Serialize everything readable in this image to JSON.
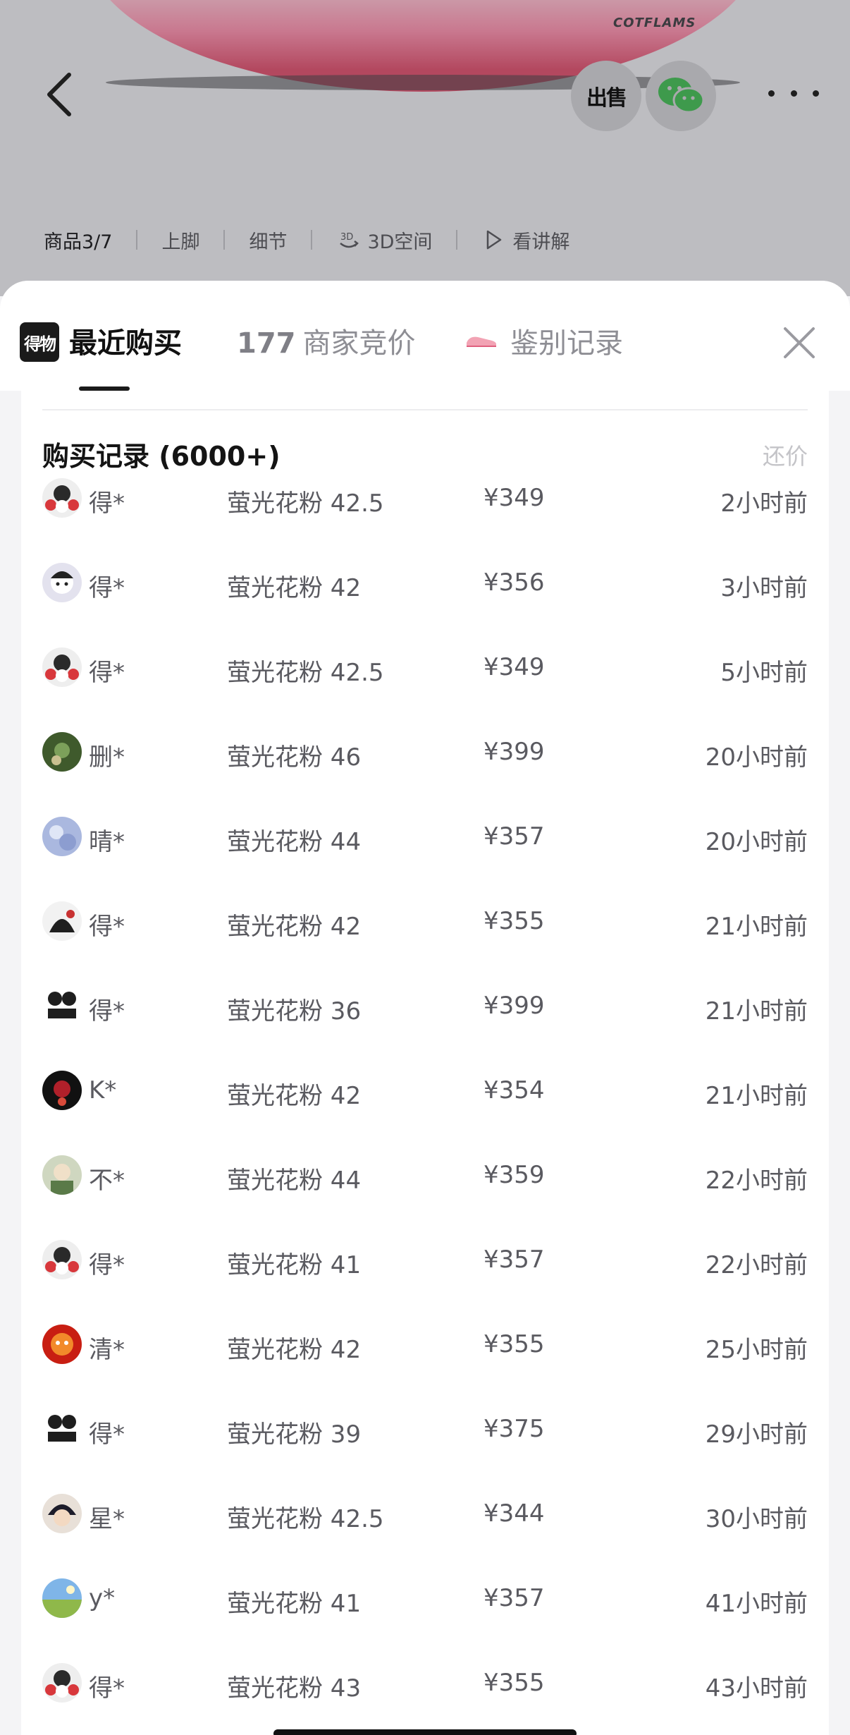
{
  "hero": {
    "brand_mark": "COTFLAMS",
    "sell_label": "出售",
    "media_tabs": [
      {
        "label": "商品3/7",
        "icon": ""
      },
      {
        "label": "上脚",
        "icon": ""
      },
      {
        "label": "细节",
        "icon": ""
      },
      {
        "label": "3D空间",
        "icon": "3d-icon"
      },
      {
        "label": "看讲解",
        "icon": "play-icon"
      }
    ]
  },
  "sheet": {
    "logo_text": "得物",
    "tabs": {
      "recent": "最近购买",
      "bids_count": "177",
      "bids_label": "商家竞价",
      "auth": "鉴别记录"
    },
    "records_title": "购买记录 (6000+)",
    "counter_offer": "还价",
    "rows": [
      {
        "user": "得*",
        "spec": "萤光花粉 42.5",
        "price": "¥349",
        "time": "2小时前",
        "avatar": "a1"
      },
      {
        "user": "得*",
        "spec": "萤光花粉 42",
        "price": "¥356",
        "time": "3小时前",
        "avatar": "a2"
      },
      {
        "user": "得*",
        "spec": "萤光花粉 42.5",
        "price": "¥349",
        "time": "5小时前",
        "avatar": "a1"
      },
      {
        "user": "删*",
        "spec": "萤光花粉 46",
        "price": "¥399",
        "time": "20小时前",
        "avatar": "a3"
      },
      {
        "user": "晴*",
        "spec": "萤光花粉 44",
        "price": "¥357",
        "time": "20小时前",
        "avatar": "a4"
      },
      {
        "user": "得*",
        "spec": "萤光花粉 42",
        "price": "¥355",
        "time": "21小时前",
        "avatar": "a5"
      },
      {
        "user": "得*",
        "spec": "萤光花粉 36",
        "price": "¥399",
        "time": "21小时前",
        "avatar": "a6"
      },
      {
        "user": "K*",
        "spec": "萤光花粉 42",
        "price": "¥354",
        "time": "21小时前",
        "avatar": "a7"
      },
      {
        "user": "不*",
        "spec": "萤光花粉 44",
        "price": "¥359",
        "time": "22小时前",
        "avatar": "a8"
      },
      {
        "user": "得*",
        "spec": "萤光花粉 41",
        "price": "¥357",
        "time": "22小时前",
        "avatar": "a1"
      },
      {
        "user": "清*",
        "spec": "萤光花粉 42",
        "price": "¥355",
        "time": "25小时前",
        "avatar": "a9"
      },
      {
        "user": "得*",
        "spec": "萤光花粉 39",
        "price": "¥375",
        "time": "29小时前",
        "avatar": "a6"
      },
      {
        "user": "星*",
        "spec": "萤光花粉 42.5",
        "price": "¥344",
        "time": "30小时前",
        "avatar": "a10"
      },
      {
        "user": "y*",
        "spec": "萤光花粉 41",
        "price": "¥357",
        "time": "41小时前",
        "avatar": "a11"
      },
      {
        "user": "得*",
        "spec": "萤光花粉 43",
        "price": "¥355",
        "time": "43小时前",
        "avatar": "a1"
      }
    ]
  },
  "colors": {
    "accent": "#1a1a1a",
    "muted_text": "#5a5a60",
    "hint_text": "#c4c4c8",
    "shoe_pink": "#e0607e"
  }
}
